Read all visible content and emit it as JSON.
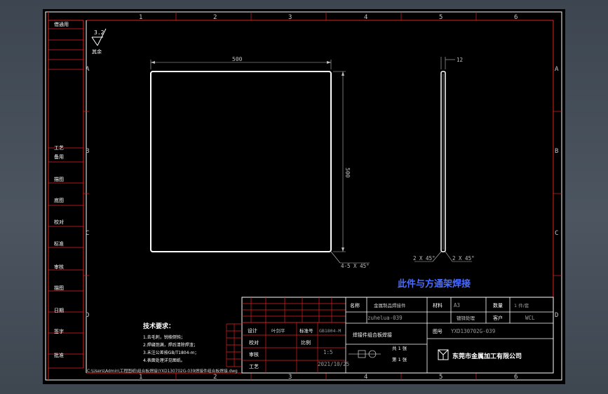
{
  "drawing_title": "此件与方通架焊接",
  "columns": [
    "1",
    "2",
    "3",
    "4",
    "5",
    "6"
  ],
  "rows": [
    "A",
    "B",
    "C",
    "D"
  ],
  "left_column_labels": [
    "借通用",
    "工艺",
    "备用",
    "描图",
    "底图",
    "校对",
    "标准",
    "审核",
    "描图",
    "日期",
    "签字",
    "批准"
  ],
  "surface_symbol": {
    "ra": "3.2",
    "note": "其余"
  },
  "front_view": {
    "width_dim": "500",
    "height_dim": "500",
    "chamfer_note": "4-5 X 45°"
  },
  "side_view": {
    "thickness_dim": "12",
    "chamfer_left": "2 X 45°",
    "chamfer_right": "2 X 45°"
  },
  "tech_requirements": {
    "heading": "技术要求：",
    "lines": [
      "1.去毛刺，锐棱倒钝；",
      "2.焊缝饱满，焊后清除焊渣；",
      "3.未注公差按GB/T1804-m；",
      "4.表面处理详见图纸。"
    ]
  },
  "title_block": {
    "name_label": "名称",
    "name_value": "金属制品焊接件",
    "drawing_no_value": "zuhelua-039",
    "material_label": "材料",
    "material_value": "A3",
    "qty_label": "数量",
    "qty_value": "1 件/套",
    "finish_value": "镀锌处理",
    "customer_label": "客户",
    "customer_value": "WCL",
    "designer_label": "设计",
    "designer_value": "叶剑平",
    "standard_label": "标准号",
    "standard_value": "GB1804-M",
    "parts_name_value": "焊接件组合板焊接",
    "drawing_id_label": "图号",
    "drawing_id_value": "YXD130702G-039",
    "checker_label": "校对",
    "ratio_label": "比例",
    "ratio_value": "1:5",
    "review_label": "审核",
    "process_label": "工艺",
    "date_value": "2021/10/25",
    "sheet_label": "共 1 张",
    "sheet_of_label": "第 1 张",
    "company": "东莞市金属加工有限公司",
    "file_path": "C:\\Users\\Admin\\工程图纸\\组合板焊接\\YXD130702G-039焊接件组合板焊接.dwg"
  }
}
